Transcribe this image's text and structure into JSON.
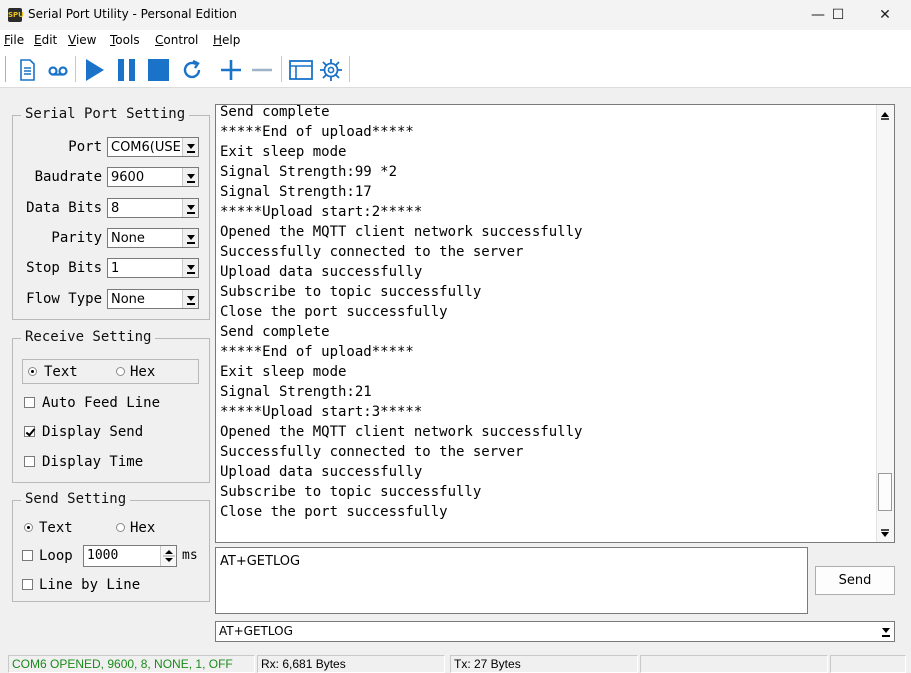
{
  "window": {
    "title": "Serial Port Utility - Personal Edition",
    "app_icon_text": "SPU",
    "minimize_symbol": "—",
    "maximize_symbol": "☐",
    "close_symbol": "✕"
  },
  "menu": {
    "items": [
      {
        "label": "File",
        "mnemonic": "F"
      },
      {
        "label": "Edit",
        "mnemonic": "E"
      },
      {
        "label": "View",
        "mnemonic": "V"
      },
      {
        "label": "Tools",
        "mnemonic": "T"
      },
      {
        "label": "Control",
        "mnemonic": "C"
      },
      {
        "label": "Help",
        "mnemonic": "H"
      }
    ]
  },
  "toolbar": {
    "icons": [
      "document-icon",
      "record-icon",
      "play-icon",
      "pause-icon",
      "stop-icon",
      "refresh-icon",
      "plus-icon",
      "minus-icon",
      "window-icon",
      "gear-icon"
    ],
    "accent_color": "#1a73c9"
  },
  "serial_port_setting": {
    "title": "Serial Port Setting",
    "port": {
      "label": "Port",
      "value": "COM6(USE"
    },
    "baudrate": {
      "label": "Baudrate",
      "value": "9600"
    },
    "data_bits": {
      "label": "Data Bits",
      "value": "8"
    },
    "parity": {
      "label": "Parity",
      "value": "None"
    },
    "stop_bits": {
      "label": "Stop Bits",
      "value": "1"
    },
    "flow_type": {
      "label": "Flow Type",
      "value": "None"
    }
  },
  "receive_setting": {
    "title": "Receive Setting",
    "text_option": "Text",
    "hex_option": "Hex",
    "selected": "Text",
    "auto_feed_line": {
      "label": "Auto Feed Line",
      "checked": false
    },
    "display_send": {
      "label": "Display Send",
      "checked": true
    },
    "display_time": {
      "label": "Display Time",
      "checked": false
    }
  },
  "send_setting": {
    "title": "Send Setting",
    "text_option": "Text",
    "hex_option": "Hex",
    "selected": "Text",
    "loop": {
      "label": "Loop",
      "checked": false,
      "interval": "1000",
      "unit": "ms"
    },
    "line_by_line": {
      "label": "Line by Line",
      "checked": false
    }
  },
  "receive_log": {
    "lines": [
      "Send complete",
      "*****End of upload*****",
      "Exit sleep mode",
      "Signal Strength:99 *2",
      "Signal Strength:17",
      "*****Upload start:2*****",
      "Opened the MQTT client network successfully",
      "Successfully connected to the server",
      "Upload data successfully",
      "Subscribe to topic successfully",
      "Close the port successfully",
      "Send complete",
      "*****End of upload*****",
      "Exit sleep mode",
      "Signal Strength:21",
      "*****Upload start:3*****",
      "Opened the MQTT client network successfully",
      "Successfully connected to the server",
      "Upload data successfully",
      "Subscribe to topic successfully",
      "Close the port successfully"
    ],
    "scroll_position": 0.93
  },
  "send_area": {
    "text": "AT+GETLOG",
    "send_button": "Send",
    "history_value": "AT+GETLOG"
  },
  "status_bar": {
    "connection": "COM6 OPENED, 9600, 8, NONE, 1, OFF",
    "rx": "Rx: 6,681 Bytes",
    "tx": "Tx: 27 Bytes",
    "connection_color": "#1a8a1a"
  }
}
